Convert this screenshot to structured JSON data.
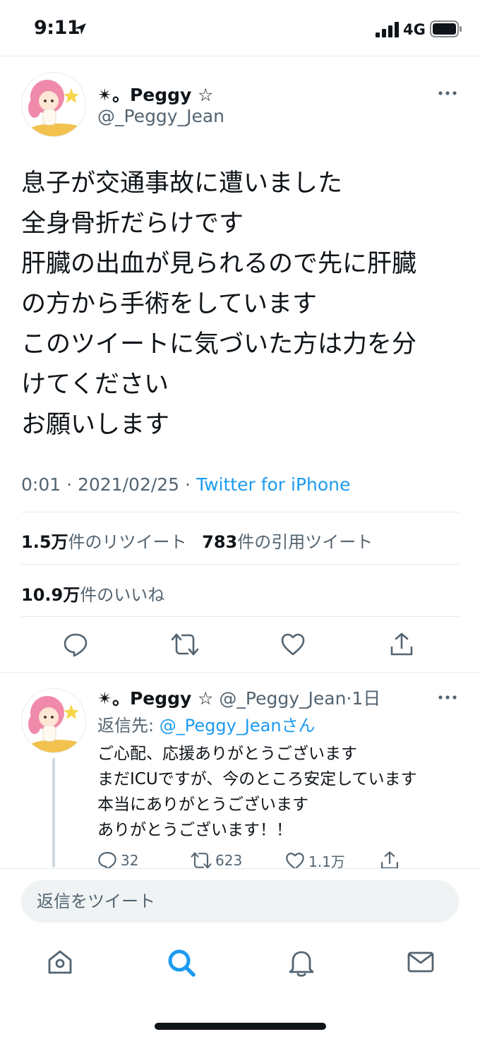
{
  "status_bar": {
    "time": "9:11",
    "network": "4G"
  },
  "tweet": {
    "display_name": "✴︎。Peggy ☆",
    "handle": "@_Peggy_Jean",
    "text_lines": [
      "息子が交通事故に遭いました",
      "全身骨折だらけです",
      "肝臓の出血が見られるので先に肝臓",
      "の方から手術をしています",
      "このツイートに気づいた方は力を分",
      "けてください",
      "お願いします"
    ],
    "time": "0:01",
    "date": "2021/02/25",
    "separator": "·",
    "source": "Twitter for iPhone",
    "retweets_count": "1.5万",
    "retweets_label": "件のリツイート",
    "quotes_count": "783",
    "quotes_label": "件の引用ツイート",
    "likes_count": "10.9万",
    "likes_label": "件のいいね"
  },
  "reply": {
    "display_name": "✴︎。Peggy ☆",
    "handle": "@_Peggy_Jean",
    "age": "·1日",
    "reply_prefix": "返信先: ",
    "reply_target": "@_Peggy_Jeanさん",
    "text_lines": [
      "ご心配、応援ありがとうございます",
      "まだICUですが、今のところ安定しています",
      "本当にありがとうございます",
      "ありがとうございます！！"
    ],
    "reply_count": "32",
    "retweet_count": "623",
    "like_count": "1.1万"
  },
  "compose": {
    "placeholder": "返信をツイート"
  },
  "tabs": [
    {
      "name": "home-icon"
    },
    {
      "name": "search-icon"
    },
    {
      "name": "bell-icon"
    },
    {
      "name": "mail-icon"
    }
  ],
  "colors": {
    "accent": "#1d9bf0",
    "secondary_text": "#536471",
    "primary_text": "#0f1419"
  }
}
